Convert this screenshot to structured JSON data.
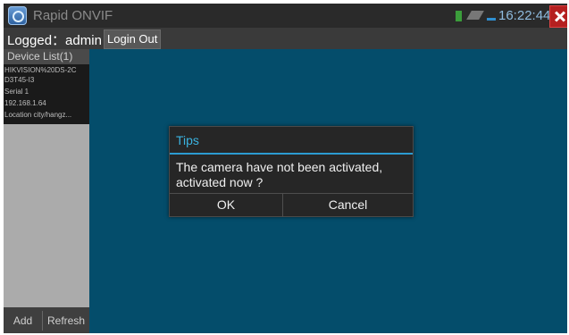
{
  "status_bar": {
    "app_title": "Rapid ONVIF",
    "clock": "16:22:44"
  },
  "login_bar": {
    "logged_text": "Logged：admin",
    "login_out_label": "Login Out"
  },
  "sidebar": {
    "header": "Device List(1)",
    "devices": [
      {
        "lines": [
          "HIKVISION%20DS-2C",
          "D3T45-I3",
          "Serial 1",
          "192.168.1.64",
          "Location city/hangz..."
        ]
      }
    ],
    "add_label": "Add",
    "refresh_label": "Refresh"
  },
  "dialog": {
    "title": "Tips",
    "message": "The camera have not been activated, activated now ?",
    "ok_label": "OK",
    "cancel_label": "Cancel"
  },
  "colors": {
    "main_background": "#044d6b",
    "dialog_accent": "#2b9bd1",
    "close_button": "#b52020"
  }
}
